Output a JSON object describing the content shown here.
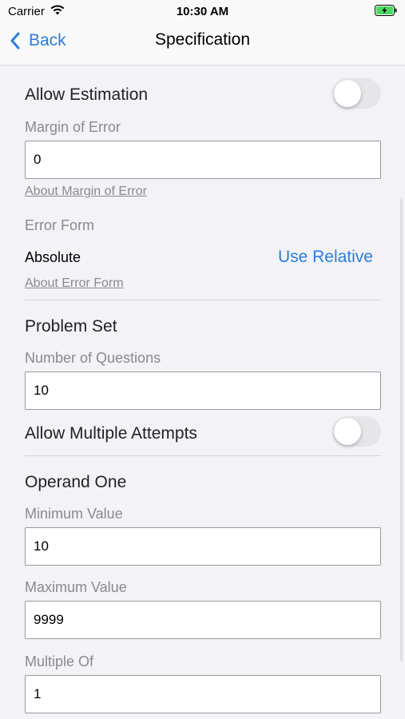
{
  "status_bar": {
    "carrier": "Carrier",
    "time": "10:30 AM"
  },
  "nav": {
    "back_label": "Back",
    "title": "Specification"
  },
  "estimation": {
    "toggle_label": "Allow Estimation",
    "toggle_on": false,
    "margin_label": "Margin of Error",
    "margin_value": "0",
    "margin_help": "About Margin of Error",
    "error_form_label": "Error Form",
    "error_form_value": "Absolute",
    "use_relative_label": "Use Relative",
    "error_form_help": "About Error Form"
  },
  "problem_set": {
    "title": "Problem Set",
    "questions_label": "Number of Questions",
    "questions_value": "10",
    "attempts_label": "Allow Multiple Attempts",
    "attempts_on": false
  },
  "operand_one": {
    "title": "Operand One",
    "min_label": "Minimum Value",
    "min_value": "10",
    "max_label": "Maximum Value",
    "max_value": "9999",
    "multiple_label": "Multiple Of",
    "multiple_value": "1"
  },
  "colors": {
    "accent": "#2b7de0",
    "background": "#f2f2f7",
    "battery": "#4cd964"
  }
}
